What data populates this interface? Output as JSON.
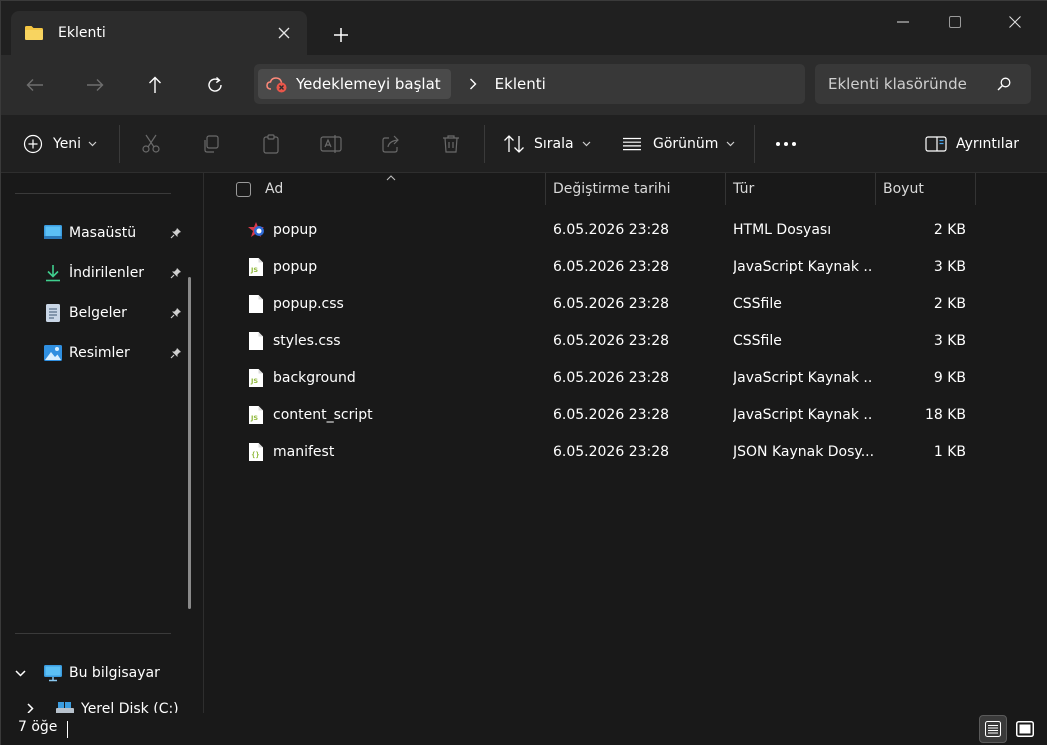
{
  "window": {
    "tab_title": "Eklenti",
    "controls": [
      "minimize",
      "maximize",
      "close"
    ]
  },
  "address": {
    "chip_label": "Yedeklemeyi başlat",
    "current": "Eklenti",
    "search_placeholder": "Eklenti klasöründe"
  },
  "toolbar": {
    "new_label": "Yeni",
    "sort_label": "Sırala",
    "view_label": "Görünüm",
    "details_label": "Ayrıntılar"
  },
  "sidebar": {
    "quick_access": [
      {
        "label": "Masaüstü",
        "icon": "desktop-icon"
      },
      {
        "label": "İndirilenler",
        "icon": "download-icon"
      },
      {
        "label": "Belgeler",
        "icon": "documents-icon"
      },
      {
        "label": "Resimler",
        "icon": "pictures-icon"
      }
    ],
    "this_pc": "Bu bilgisayar",
    "local_disk": "Yerel Disk (C:)"
  },
  "columns": {
    "name": "Ad",
    "modified": "Değiştirme tarihi",
    "type": "Tür",
    "size": "Boyut"
  },
  "files": [
    {
      "name": "popup",
      "date": "6.05.2026 23:28",
      "type": "HTML Dosyası",
      "size": "2 KB",
      "icon": "html-file-icon"
    },
    {
      "name": "popup",
      "date": "6.05.2026 23:28",
      "type": "JavaScript Kaynak ...",
      "size": "3 KB",
      "icon": "js-file-icon"
    },
    {
      "name": "popup.css",
      "date": "6.05.2026 23:28",
      "type": "CSSfile",
      "size": "2 KB",
      "icon": "blank-file-icon"
    },
    {
      "name": "styles.css",
      "date": "6.05.2026 23:28",
      "type": "CSSfile",
      "size": "3 KB",
      "icon": "blank-file-icon"
    },
    {
      "name": "background",
      "date": "6.05.2026 23:28",
      "type": "JavaScript Kaynak ...",
      "size": "9 KB",
      "icon": "js-file-icon"
    },
    {
      "name": "content_script",
      "date": "6.05.2026 23:28",
      "type": "JavaScript Kaynak ...",
      "size": "18 KB",
      "icon": "js-file-icon"
    },
    {
      "name": "manifest",
      "date": "6.05.2026 23:28",
      "type": "JSON Kaynak Dosy...",
      "size": "1 KB",
      "icon": "json-file-icon"
    }
  ],
  "status": {
    "item_count": "7 öğe"
  },
  "colors": {
    "background": "#191919",
    "titlebar": "#202020",
    "navrow": "#2c2c2c",
    "field": "#383838",
    "folder_yellow": "#f4c542",
    "js_green": "#8fb93a"
  }
}
